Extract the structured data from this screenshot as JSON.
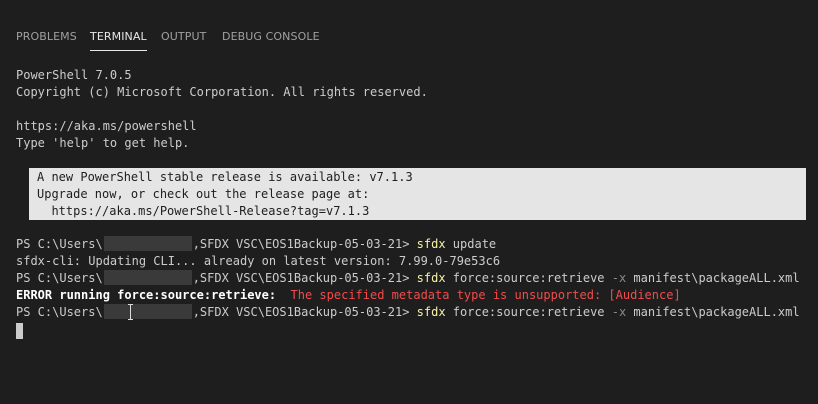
{
  "tabs": [
    {
      "label": "PROBLEMS",
      "active": false
    },
    {
      "label": "TERMINAL",
      "active": true
    },
    {
      "label": "OUTPUT",
      "active": false
    },
    {
      "label": "DEBUG CONSOLE",
      "active": false
    }
  ],
  "terminal": {
    "header": [
      "PowerShell 7.0.5",
      "Copyright (c) Microsoft Corporation. All rights reserved.",
      "",
      "https://aka.ms/powershell",
      "Type 'help' to get help."
    ],
    "notice": [
      "A new PowerShell stable release is available: v7.1.3",
      "Upgrade now, or check out the release page at:",
      "  https://aka.ms/PowerShell-Release?tag=v7.1.3"
    ],
    "prompt_prefix": "PS C:\\Users\\",
    "prompt_suffix": ",SFDX VSC\\EOS1Backup-05-03-21> ",
    "commands": [
      {
        "cmd": "sfdx",
        "args": " update",
        "flag": "",
        "rest": ""
      },
      {
        "cmd": "sfdx",
        "args": " force:source:retrieve ",
        "flag": "-x",
        "rest": " manifest\\packageALL.xml"
      },
      {
        "cmd": "sfdx",
        "args": " force:source:retrieve ",
        "flag": "-x",
        "rest": " manifest\\packageALL.xml"
      }
    ],
    "update_output": "sfdx-cli: Updating CLI... already on latest version: 7.99.0-79e53c6",
    "error_label": "ERROR running force:source:retrieve: ",
    "error_message": " The specified metadata type is unsupported: [Audience]"
  },
  "colors": {
    "background": "#1e1e1e",
    "command": "#f9f1a5",
    "error": "#f14c4c"
  }
}
